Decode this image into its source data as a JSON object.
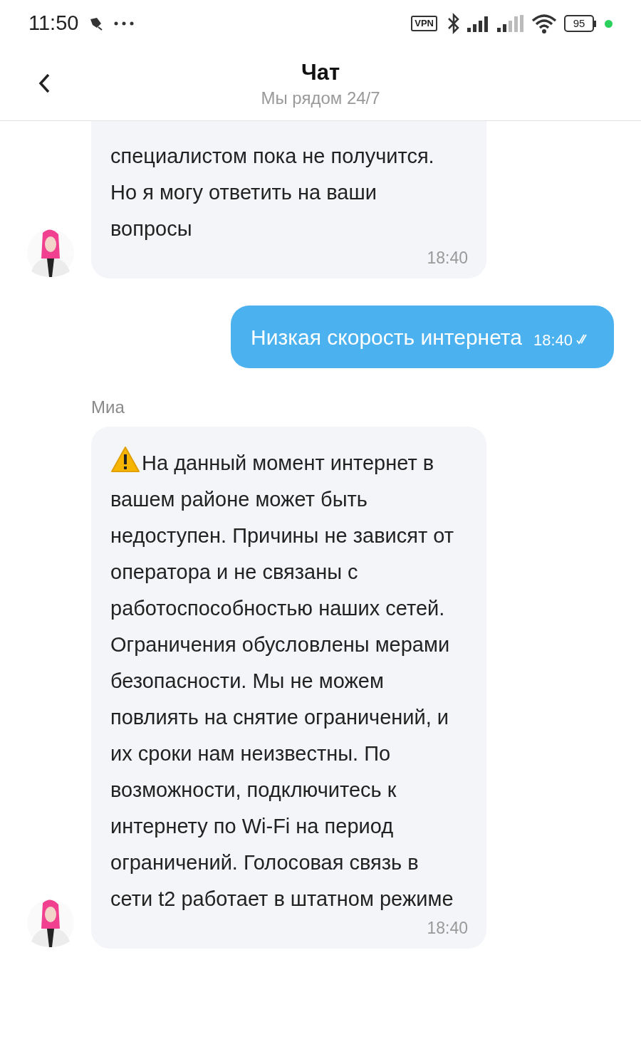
{
  "status_bar": {
    "time": "11:50",
    "vpn": "VPN",
    "battery": "95"
  },
  "header": {
    "title": "Чат",
    "subtitle": "Мы рядом 24/7"
  },
  "messages": [
    {
      "kind": "incoming",
      "text": "специалистом пока не получится. Но я могу ответить на ваши вопросы",
      "time": "18:40"
    },
    {
      "kind": "outgoing",
      "text": "Низкая скорость интернета",
      "time": "18:40",
      "read": true
    },
    {
      "kind": "incoming",
      "sender": "Миа",
      "text": "На данный момент интернет в вашем районе может быть недоступен. Причины не зависят от оператора и не связаны с работоспособностью наших сетей. Ограничения обусловлены мерами безопасности. Мы не можем повлиять на снятие ограничений, и их сроки нам неизвестны. По возможности, подключитесь к интернету по Wi-Fi на период ограничений. Голосовая связь в сети t2 работает в штатном режиме",
      "time": "18:40",
      "warning": true
    }
  ]
}
